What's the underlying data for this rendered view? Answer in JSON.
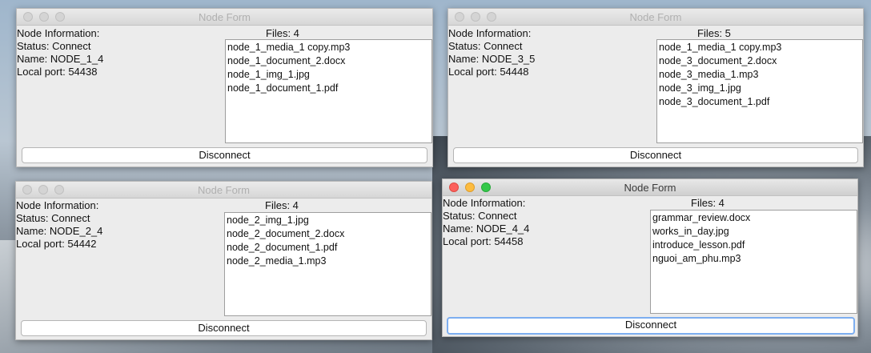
{
  "windows": [
    {
      "title": "Node Form",
      "info_label": "Node Information:",
      "status": "Status: Connect",
      "name": "Name: NODE_1_4",
      "port": "Local port: 54438",
      "files_label": "Files: 4",
      "files": [
        "node_1_media_1 copy.mp3",
        "node_1_document_2.docx",
        "node_1_img_1.jpg",
        "node_1_document_1.pdf"
      ],
      "button": "Disconnect",
      "active": false
    },
    {
      "title": "Node Form",
      "info_label": "Node Information:",
      "status": "Status: Connect",
      "name": "Name: NODE_3_5",
      "port": "Local port: 54448",
      "files_label": "Files: 5",
      "files": [
        "node_1_media_1 copy.mp3",
        "node_3_document_2.docx",
        "node_3_media_1.mp3",
        "node_3_img_1.jpg",
        "node_3_document_1.pdf"
      ],
      "button": "Disconnect",
      "active": false
    },
    {
      "title": "Node Form",
      "info_label": "Node Information:",
      "status": "Status: Connect",
      "name": "Name: NODE_2_4",
      "port": "Local port: 54442",
      "files_label": "Files: 4",
      "files": [
        "node_2_img_1.jpg",
        "node_2_document_2.docx",
        "node_2_document_1.pdf",
        "node_2_media_1.mp3"
      ],
      "button": "Disconnect",
      "active": false
    },
    {
      "title": "Node Form",
      "info_label": "Node Information:",
      "status": "Status: Connect",
      "name": "Name: NODE_4_4",
      "port": "Local port: 54458",
      "files_label": "Files: 4",
      "files": [
        "grammar_review.docx",
        "works_in_day.jpg",
        "introduce_lesson.pdf",
        "nguoi_am_phu.mp3"
      ],
      "button": "Disconnect",
      "active": true
    }
  ]
}
